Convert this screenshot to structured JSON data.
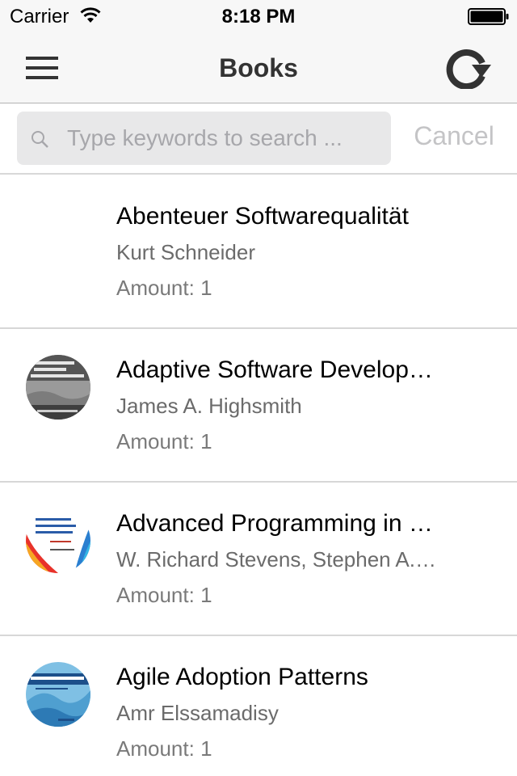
{
  "status_bar": {
    "carrier": "Carrier",
    "time": "8:18 PM"
  },
  "nav": {
    "title": "Books",
    "menu_icon": "hamburger-icon",
    "refresh_icon": "refresh-icon"
  },
  "search": {
    "placeholder": "Type keywords to search ...",
    "value": "",
    "cancel_label": "Cancel"
  },
  "amount_label": "Amount:",
  "books": [
    {
      "title": "Abenteuer Softwarequalität",
      "author": "Kurt Schneider",
      "amount": "1",
      "cover": "none"
    },
    {
      "title": "Adaptive Software Development",
      "author": "James A. Highsmith",
      "amount": "1",
      "cover": "grey-book-cover"
    },
    {
      "title": "Advanced Programming in the UNIX Environment",
      "author": "W. Richard Stevens, Stephen A. Rago",
      "amount": "1",
      "cover": "white-colorful-book-cover"
    },
    {
      "title": "Agile Adoption Patterns",
      "author": "Amr Elssamadisy",
      "amount": "1",
      "cover": "blue-book-cover"
    }
  ],
  "colors": {
    "bar_background": "#f7f7f7",
    "title_text": "#333333",
    "secondary_text": "#6b6b6b",
    "search_field": "#e8e8e9",
    "cancel_text": "#c4c4c6",
    "separator": "#d7d7d7"
  }
}
